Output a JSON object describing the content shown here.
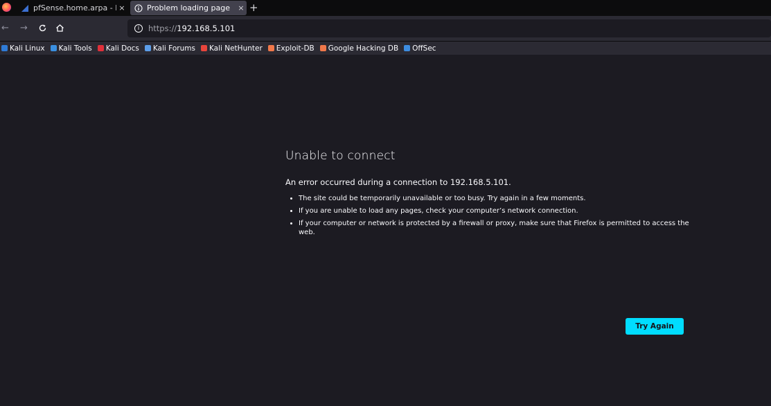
{
  "tabs": [
    {
      "title": "pfSense.home.arpa - Fire",
      "icon": "pfsense-icon",
      "active": false
    },
    {
      "title": "Problem loading page",
      "icon": "info-icon",
      "active": true
    }
  ],
  "new_tab_label": "+",
  "tab_close": "×",
  "url": {
    "scheme": "https://",
    "host": "192.168.5.101"
  },
  "bookmarks": [
    {
      "label": "Kali Linux",
      "icon": "kali-icon",
      "color": "#2f7bd6"
    },
    {
      "label": "Kali Tools",
      "icon": "kali-tools-icon",
      "color": "#3a8fe0"
    },
    {
      "label": "Kali Docs",
      "icon": "kali-docs-icon",
      "color": "#e0303a"
    },
    {
      "label": "Kali Forums",
      "icon": "kali-forums-icon",
      "color": "#5c9de8"
    },
    {
      "label": "Kali NetHunter",
      "icon": "nethunter-icon",
      "color": "#e8453c"
    },
    {
      "label": "Exploit-DB",
      "icon": "exploit-db-icon",
      "color": "#f0784a"
    },
    {
      "label": "Google Hacking DB",
      "icon": "ghdb-icon",
      "color": "#f0784a"
    },
    {
      "label": "OffSec",
      "icon": "offsec-icon",
      "color": "#3d8de0"
    }
  ],
  "error": {
    "title": "Unable to connect",
    "description": "An error occurred during a connection to 192.168.5.101.",
    "items": [
      "The site could be temporarily unavailable or too busy. Try again in a few moments.",
      "If you are unable to load any pages, check your computer’s network connection.",
      "If your computer or network is protected by a firewall or proxy, make sure that Firefox is permitted to access the web."
    ],
    "button": "Try Again"
  },
  "colors": {
    "accent": "#00ddff",
    "background": "#1c1b22",
    "toolbar": "#2b2a33"
  }
}
